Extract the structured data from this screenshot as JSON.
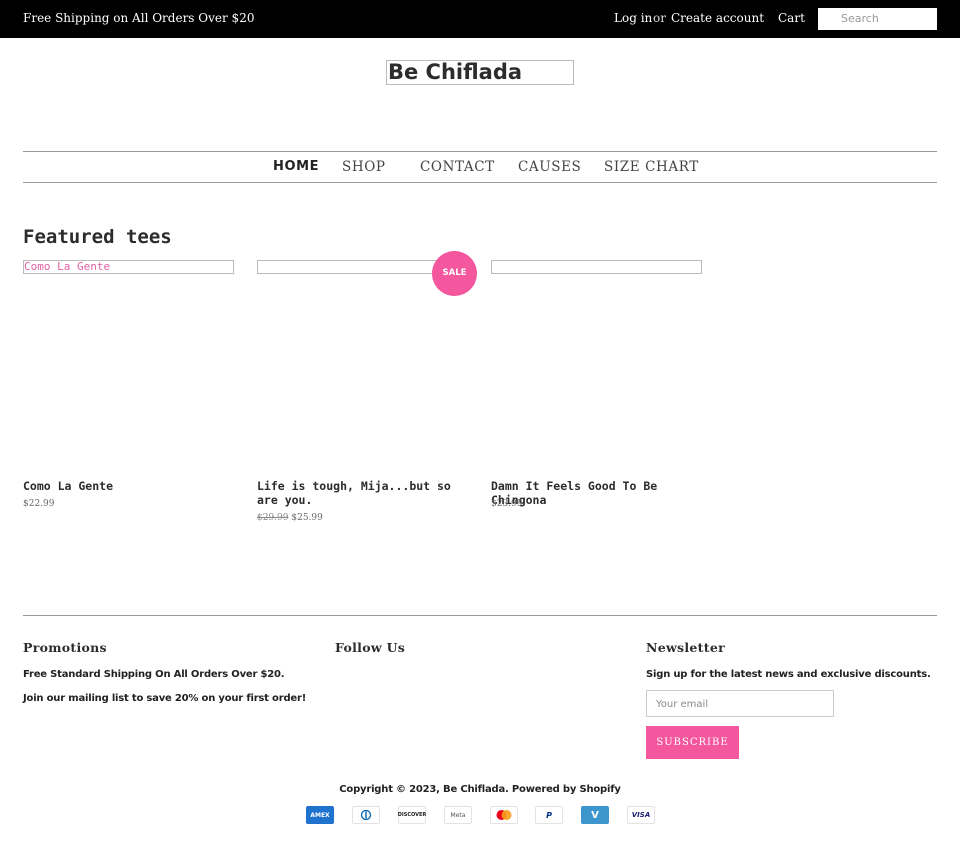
{
  "topbar": {
    "promo": "Free Shipping on All Orders Over $20",
    "login": "Log in",
    "or": "or",
    "create_account": "Create account",
    "cart": "Cart",
    "search_placeholder": "Search"
  },
  "logo": {
    "text": "Be Chiflada"
  },
  "nav": {
    "items": [
      {
        "label": "HOME",
        "active": true
      },
      {
        "label": "SHOP"
      },
      {
        "label": "CONTACT"
      },
      {
        "label": "CAUSES"
      },
      {
        "label": "SIZE CHART"
      }
    ]
  },
  "featured": {
    "title": "Featured tees",
    "sale_badge": "SALE",
    "products": [
      {
        "image_alt": "Como La Gente",
        "title": "Como La Gente",
        "price": "$22.99"
      },
      {
        "image_alt": "",
        "title": "Life is tough, Mija...but so are you.",
        "original_price": "$29.99",
        "price": "$25.99"
      },
      {
        "image_alt": "",
        "title": "Damn It Feels Good To Be Chingona",
        "price": "$23.99"
      }
    ]
  },
  "footer": {
    "promotions": {
      "heading": "Promotions",
      "line1": "Free Standard Shipping On All Orders Over $20.",
      "line2": "Join our mailing list to save 20% on your first order!"
    },
    "follow": {
      "heading": "Follow Us"
    },
    "newsletter": {
      "heading": "Newsletter",
      "text": "Sign up for the latest news and exclusive discounts.",
      "email_placeholder": "Your email",
      "subscribe_label": "SUBSCRIBE"
    },
    "copyright": "Copyright © 2023, Be Chiflada. Powered by Shopify",
    "payments": [
      {
        "icon": "amex-icon",
        "label": "AMEX",
        "color": "#1f72cd"
      },
      {
        "icon": "diners-icon",
        "label": "",
        "color": "#0165ac"
      },
      {
        "icon": "discover-icon",
        "label": "DISCOVER",
        "color": "#f38020"
      },
      {
        "icon": "meta-pay-icon",
        "label": "Meta",
        "color": "#555555"
      },
      {
        "icon": "mastercard-icon",
        "label": "",
        "color": "#eb001b"
      },
      {
        "icon": "paypal-icon",
        "label": "P",
        "color": "#003087"
      },
      {
        "icon": "venmo-icon",
        "label": "V",
        "color": "#3d95ce"
      },
      {
        "icon": "visa-icon",
        "label": "VISA",
        "color": "#1a1f71"
      }
    ]
  },
  "colors": {
    "accent": "#f4579e",
    "topbar_bg": "#000000"
  }
}
